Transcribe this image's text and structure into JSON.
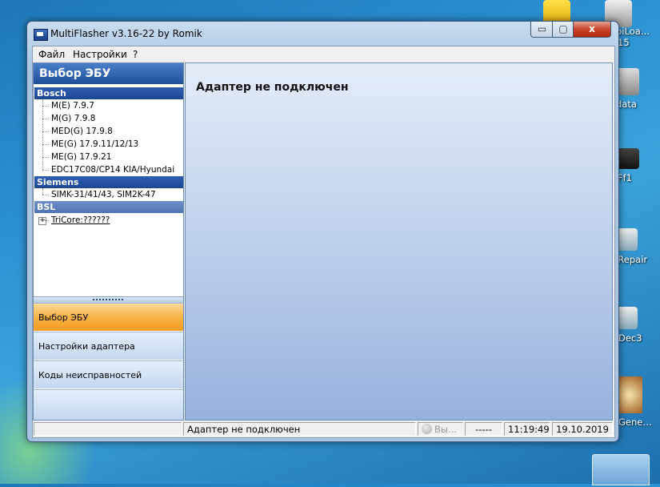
{
  "window": {
    "title": "MultiFlasher v3.16-22 by Romik",
    "close_glyph": "x",
    "min_glyph": "▭",
    "max_glyph": "▢"
  },
  "menu": {
    "file": "Файл",
    "settings": "Настройки",
    "help": "?"
  },
  "sidebar": {
    "header": "Выбор ЭБУ",
    "groups": [
      {
        "name": "Bosch",
        "items": [
          "M(E) 7.9.7",
          "M(G) 7.9.8",
          "MED(G) 17.9.8",
          "ME(G) 17.9.11/12/13",
          "ME(G) 17.9.21",
          "EDC17C08/CP14 KIA/Hyundai"
        ]
      },
      {
        "name": "Siemens",
        "items": [
          "SIMK-31/41/43, SIM2K-47"
        ]
      },
      {
        "name": "BSL",
        "items": [
          "TriCore:??????"
        ]
      }
    ],
    "expander": "+",
    "nav": [
      "Выбор ЭБУ",
      "Настройки адаптера",
      "Коды неисправностей"
    ],
    "active_nav": "Выбор ЭБУ"
  },
  "main": {
    "title": "Адаптер не подключен"
  },
  "status": {
    "message": "Адаптер не подключен",
    "led_label": "Вы...",
    "value": "-----",
    "time": "11:19:49",
    "date": "19.10.2019"
  },
  "desktop": {
    "icons": [
      "biLoa…",
      "15",
      "data",
      "Ff1",
      "gRepair",
      "Dec3",
      "Gene…"
    ],
    "accent": "#2a8fd0"
  }
}
